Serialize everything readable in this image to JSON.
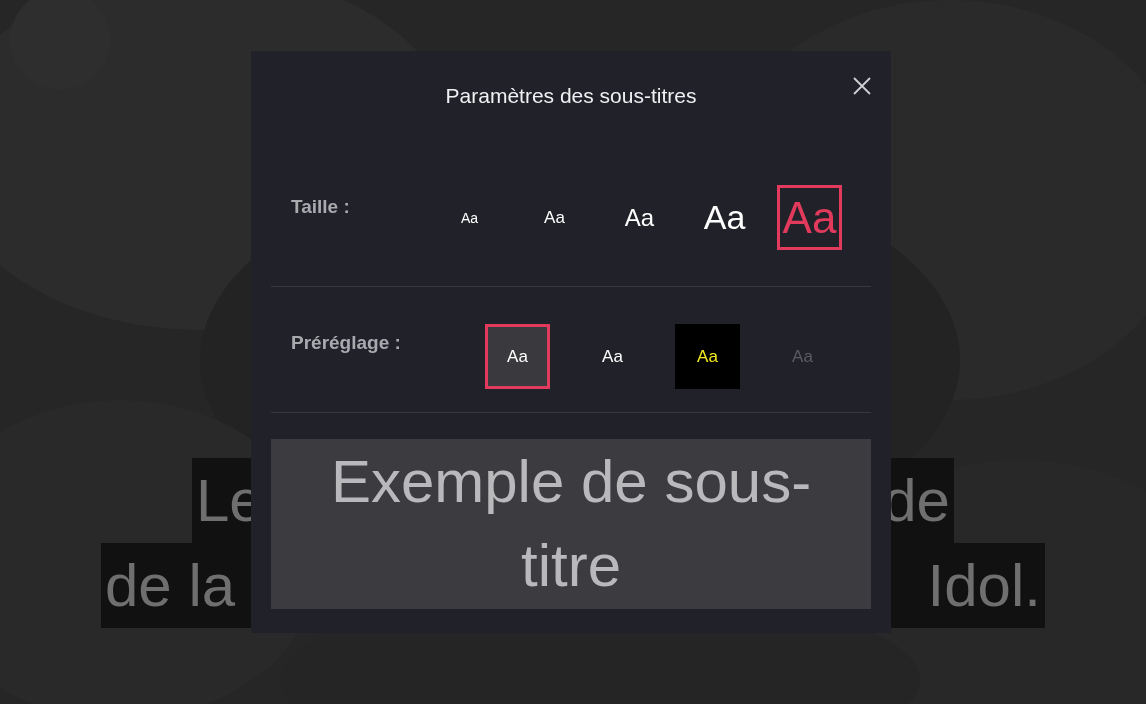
{
  "subtitle_background": {
    "lines": [
      {
        "left": "Le",
        "right": "de"
      },
      {
        "left": "de la",
        "right": "Idol."
      }
    ]
  },
  "dialog": {
    "title": "Paramètres des sous-titres",
    "size": {
      "label": "Taille :",
      "options": [
        {
          "label": "Aa",
          "selected": false
        },
        {
          "label": "Aa",
          "selected": false
        },
        {
          "label": "Aa",
          "selected": false
        },
        {
          "label": "Aa",
          "selected": false
        },
        {
          "label": "Aa",
          "selected": true
        }
      ]
    },
    "preset": {
      "label": "Préréglage :",
      "options": [
        {
          "label": "Aa",
          "kind": "grey",
          "selected": true
        },
        {
          "label": "Aa",
          "kind": "plain",
          "selected": false
        },
        {
          "label": "Aa",
          "kind": "black-yellow",
          "selected": false
        },
        {
          "label": "Aa",
          "kind": "dark-text",
          "selected": false
        }
      ]
    },
    "preview": {
      "text": "Exemple de sous-titre"
    }
  }
}
